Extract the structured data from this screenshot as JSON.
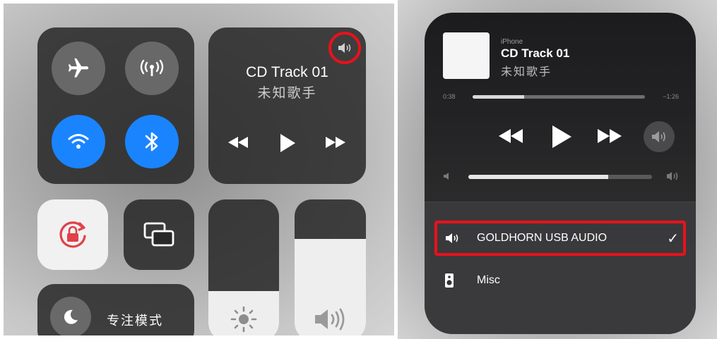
{
  "left": {
    "media": {
      "title": "CD Track 01",
      "artist": "未知歌手"
    },
    "focus": {
      "label": "专注模式"
    },
    "brightness_level": 0.35,
    "volume_level": 0.72,
    "icons": {
      "airplane": "airplane-icon",
      "cellular": "cellular-icon",
      "wifi": "wifi-icon",
      "bluetooth": "bluetooth-icon",
      "rotation_lock": "rotation-lock-icon",
      "screen_mirroring": "screen-mirroring-icon",
      "brightness": "sun-icon",
      "volume": "speaker-icon",
      "focus": "moon-icon",
      "audio_output": "speaker-icon"
    }
  },
  "right": {
    "source": "iPhone",
    "title": "CD Track 01",
    "artist": "未知歌手",
    "elapsed": "0:38",
    "remaining": "−1:26",
    "progress": 0.3,
    "volume_level": 0.76,
    "devices": [
      {
        "name": "GOLDHORN USB AUDIO",
        "selected": true,
        "icon": "speaker-icon"
      },
      {
        "name": "Misc",
        "selected": false,
        "icon": "speaker-box-icon"
      }
    ],
    "check_mark": "✓"
  },
  "colors": {
    "accent_blue": "#1a84ff",
    "highlight_red": "#e8121b",
    "rotation_lock_red": "#e0414a"
  }
}
